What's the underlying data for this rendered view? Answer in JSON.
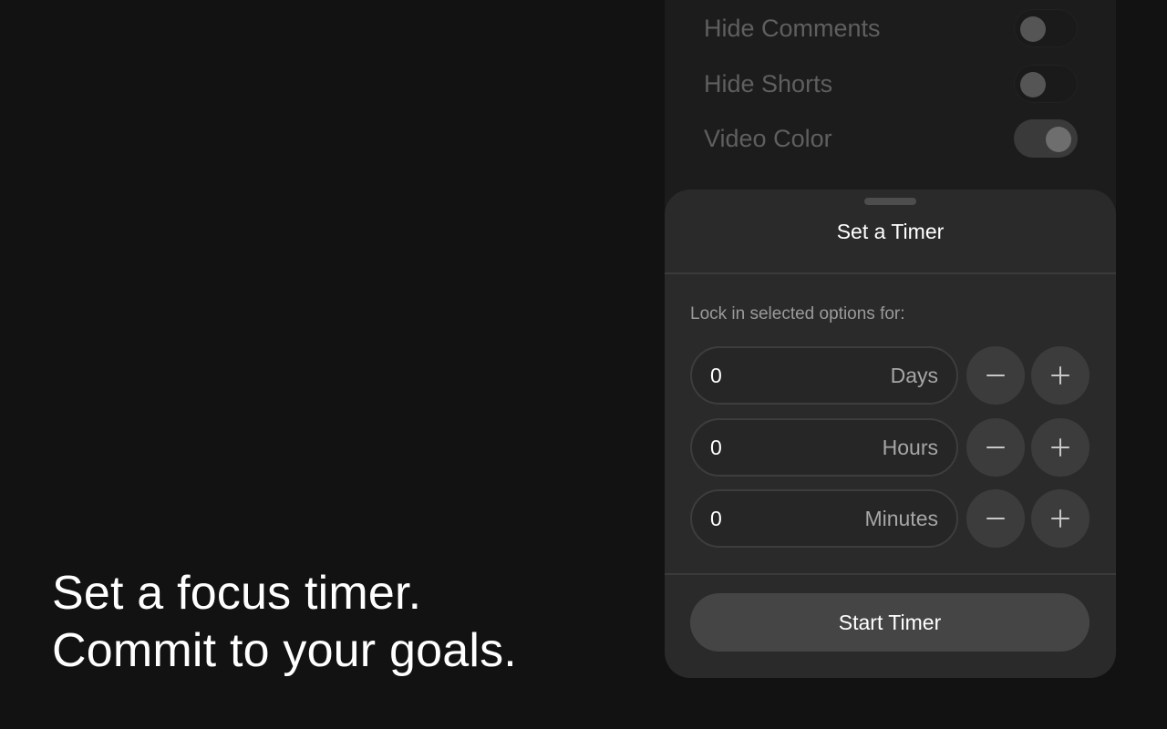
{
  "headline": {
    "line1": "Set a focus timer.",
    "line2": "Commit to your goals."
  },
  "settings": [
    {
      "label": "Hide Comments",
      "enabled": false
    },
    {
      "label": "Hide Shorts",
      "enabled": false
    },
    {
      "label": "Video Color",
      "enabled": true
    }
  ],
  "timer_sheet": {
    "title": "Set a Timer",
    "lock_label": "Lock in selected options for:",
    "rows": [
      {
        "value": "0",
        "unit": "Days"
      },
      {
        "value": "0",
        "unit": "Hours"
      },
      {
        "value": "0",
        "unit": "Minutes"
      }
    ],
    "decrement_icon": "minus-icon",
    "increment_icon": "plus-icon",
    "start_label": "Start Timer"
  },
  "colors": {
    "background": "#121212",
    "sheet": "#2a2a2a",
    "button": "#3c3c3c",
    "primary_button": "#454545",
    "text_primary": "#ffffff",
    "text_muted": "#9a9a9a"
  }
}
